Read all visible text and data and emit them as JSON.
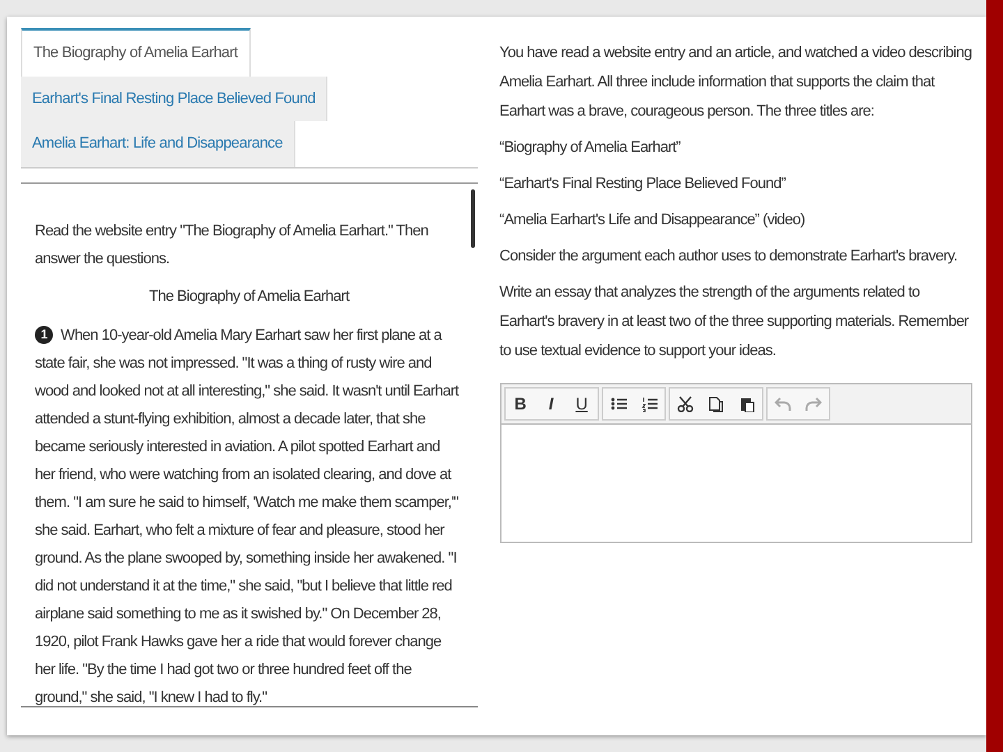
{
  "tabs": [
    {
      "label": "The Biography of Amelia Earhart",
      "selected": true
    },
    {
      "label": "Earhart's Final Resting Place Believed Found",
      "selected": false
    },
    {
      "label": "Amelia Earhart: Life and Disappearance",
      "selected": false
    }
  ],
  "passage": {
    "instruction": "Read the website entry \"The Biography of Amelia Earhart.\" Then answer the questions.",
    "title": "The Biography of Amelia Earhart",
    "paragraphs": [
      {
        "number": "1",
        "text": "When 10-year-old Amelia Mary Earhart saw her first plane at a state fair, she was not impressed. \"It was a thing of rusty wire and wood and looked not at all interesting,\" she said. It wasn't until Earhart attended a stunt-flying exhibition, almost a decade later, that she became seriously interested in aviation. A pilot spotted Earhart and her friend, who were watching from an isolated clearing, and dove at them. \"I am sure he said to himself, 'Watch me make them scamper,'\" she said. Earhart, who felt a mixture of fear and pleasure, stood her ground. As the plane swooped by, something inside her awakened. \"I did not understand it at the time,\" she said, \"but I believe that little red airplane said something to me as it swished by.\" On December 28, 1920, pilot Frank Hawks gave her a ride that would forever change her life. \"By the time I had got two or three hundred feet off the ground,\" she said, \"I knew I had to fly.\""
      }
    ]
  },
  "prompt": {
    "paragraphs": [
      "You have read a website entry and an article, and watched a video describing Amelia Earhart. All three include information that supports the claim that Earhart was a brave, courageous person. The three titles are:",
      "“Biography of Amelia Earhart”",
      "“Earhart's Final Resting Place Believed Found”",
      "“Amelia Earhart's Life and Disappearance” (video)",
      "Consider the argument each author uses to demonstrate Earhart's bravery.",
      "Write an essay that analyzes the strength of the arguments related to Earhart's bravery in at least two of the three supporting materials. Remember to use textual evidence to support your ideas."
    ]
  },
  "editor": {
    "toolbar": [
      [
        {
          "kind": "bold",
          "label": "B",
          "disabled": false
        },
        {
          "kind": "italic",
          "label": "I",
          "disabled": false
        },
        {
          "kind": "underline",
          "label": "U",
          "disabled": false
        }
      ],
      [
        {
          "kind": "bullets",
          "disabled": false
        },
        {
          "kind": "numbers",
          "disabled": false
        }
      ],
      [
        {
          "kind": "cut",
          "disabled": false
        },
        {
          "kind": "copy",
          "disabled": false
        },
        {
          "kind": "paste",
          "disabled": false
        }
      ],
      [
        {
          "kind": "undo",
          "disabled": true
        },
        {
          "kind": "redo",
          "disabled": true
        }
      ]
    ]
  }
}
